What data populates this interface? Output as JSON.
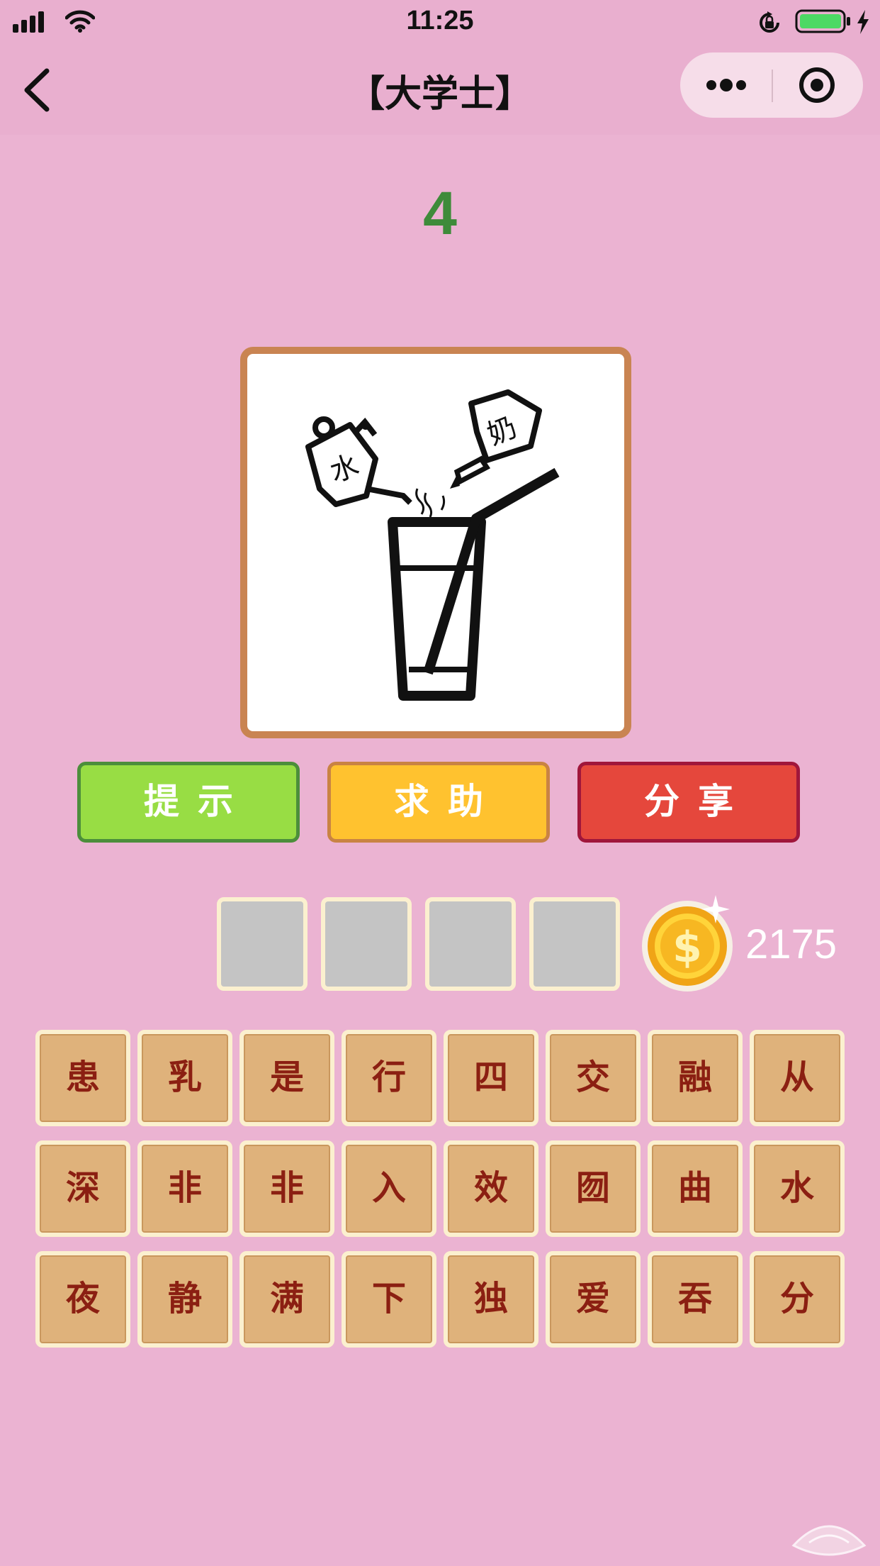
{
  "status_bar": {
    "time": "11:25"
  },
  "nav": {
    "title": "【大学士】"
  },
  "level": {
    "number": "4"
  },
  "puzzle": {
    "pot_label": "水",
    "bottle_label": "奶"
  },
  "actions": {
    "hint": "提示",
    "help": "求助",
    "share": "分享"
  },
  "answer": {
    "slots": [
      "",
      "",
      "",
      ""
    ]
  },
  "coins": {
    "count": "2175"
  },
  "tiles": [
    "患",
    "乳",
    "是",
    "行",
    "四",
    "交",
    "融",
    "从",
    "深",
    "非",
    "非",
    "入",
    "效",
    "囫",
    "曲",
    "水",
    "夜",
    "静",
    "满",
    "下",
    "独",
    "爱",
    "吞",
    "分"
  ],
  "colors": {
    "background": "#EBB3D2",
    "level_number": "#3E8B3A",
    "hint_button": "#98DD44",
    "help_button": "#FFC22F",
    "share_button": "#E5473C",
    "tile": "#DFB27B",
    "tile_text": "#8B1F12"
  }
}
